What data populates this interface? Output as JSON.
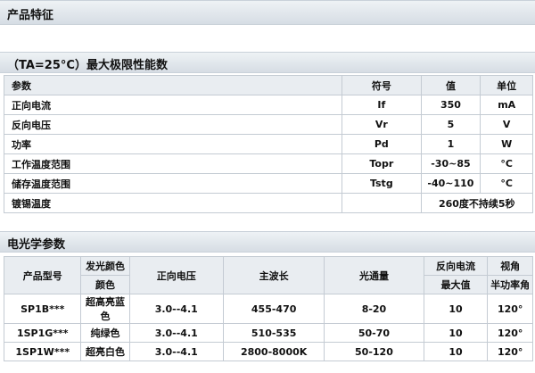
{
  "title": "产品特征",
  "max_section": {
    "heading": "（TA=25°C）最大极限性能数",
    "headers": [
      "参数",
      "符号",
      "值",
      "单位"
    ],
    "rows": [
      {
        "param": "正向电流",
        "symbol": "If",
        "value": "350",
        "unit": "mA"
      },
      {
        "param": "反向电压",
        "symbol": "Vr",
        "value": "5",
        "unit": "V"
      },
      {
        "param": "功率",
        "symbol": "Pd",
        "value": "1",
        "unit": "W"
      },
      {
        "param": "工作温度范围",
        "symbol": "Topr",
        "value": "-30~85",
        "unit": "°C"
      },
      {
        "param": "储存温度范围",
        "symbol": "Tstg",
        "value": "-40~110",
        "unit": "°C"
      }
    ],
    "solder": {
      "param": "镀锡温度",
      "value": "260度不持续5秒"
    }
  },
  "eo_section": {
    "heading": "电光学参数",
    "headers": {
      "model": "产品型号",
      "emit_color": "发光颜色",
      "color": "颜色",
      "forward_voltage": "正向电压",
      "wavelength": "主波长",
      "flux": "光通量",
      "reverse_current": "反向电流",
      "max_value": "最大值",
      "view_angle": "视角",
      "half_power": "半功率角"
    },
    "rows": [
      {
        "model": "SP1B***",
        "color": "超高亮蓝色",
        "voltage": "3.0--4.1",
        "wavelength": "455-470",
        "flux": "8-20",
        "reverse": "10",
        "angle": "120°"
      },
      {
        "model": "1SP1G***",
        "color": "纯绿色",
        "voltage": "3.0--4.1",
        "wavelength": "510-535",
        "flux": "50-70",
        "reverse": "10",
        "angle": "120°"
      },
      {
        "model": "1SP1W***",
        "color": "超亮白色",
        "voltage": "3.0--4.1",
        "wavelength": "2800-8000K",
        "flux": "50-120",
        "reverse": "10",
        "angle": "120°"
      }
    ]
  }
}
